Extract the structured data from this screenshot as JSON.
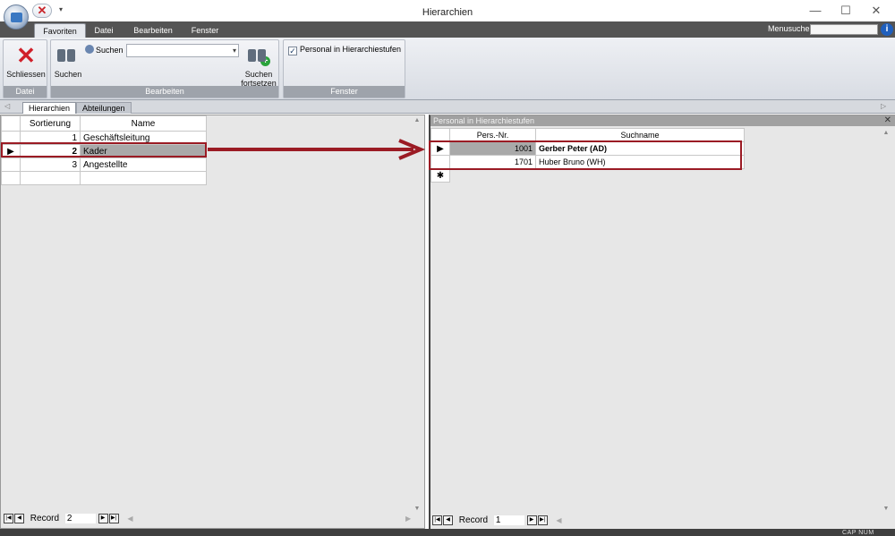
{
  "window": {
    "title": "Hierarchien",
    "minimize": "—",
    "maximize": "☐",
    "close": "✕"
  },
  "quick_access": {
    "close_icon": "✕",
    "menu_glyph": "▾"
  },
  "ribbon": {
    "tabs": [
      "Favoriten",
      "Datei",
      "Bearbeiten",
      "Fenster"
    ],
    "active_tab": "Favoriten",
    "menusuche_label": "Menusuche",
    "menusuche_value": "",
    "help": "i",
    "groups": {
      "datei": {
        "label": "Datei",
        "schliessen": "Schliessen"
      },
      "bearbeiten": {
        "label": "Bearbeiten",
        "suchen": "Suchen",
        "suchen_small": "Suchen",
        "search_value": "",
        "suchen_fortsetzen_1": "Suchen",
        "suchen_fortsetzen_2": "fortsetzen"
      },
      "fenster": {
        "label": "Fenster",
        "checkbox_label": "Personal in Hierarchiestufen",
        "checked": true
      }
    }
  },
  "doc_tabs": [
    "Hierarchien",
    "Abteilungen"
  ],
  "active_doc_tab": "Hierarchien",
  "left_grid": {
    "columns": [
      "Sortierung",
      "Name"
    ],
    "rows": [
      {
        "sortierung": "1",
        "name": "Geschäftsleitung"
      },
      {
        "sortierung": "2",
        "name": "Kader"
      },
      {
        "sortierung": "3",
        "name": "Angestellte"
      }
    ],
    "selected_row_index": 1
  },
  "left_nav": {
    "label": "Record",
    "value": "2"
  },
  "right_pane": {
    "header": "Personal in Hierarchiestufen",
    "columns": [
      "Pers.-Nr.",
      "Suchname"
    ],
    "rows": [
      {
        "nr": "1001",
        "name": "Gerber Peter (AD)"
      },
      {
        "nr": "1701",
        "name": "Huber Bruno (WH)"
      }
    ],
    "new_row_marker": "✱"
  },
  "right_nav": {
    "label": "Record",
    "value": "1"
  },
  "status": {
    "cap": "CAP",
    "num": "NUM"
  },
  "colors": {
    "annotation_red": "#9b1b24",
    "tabstrip": "#545454"
  }
}
